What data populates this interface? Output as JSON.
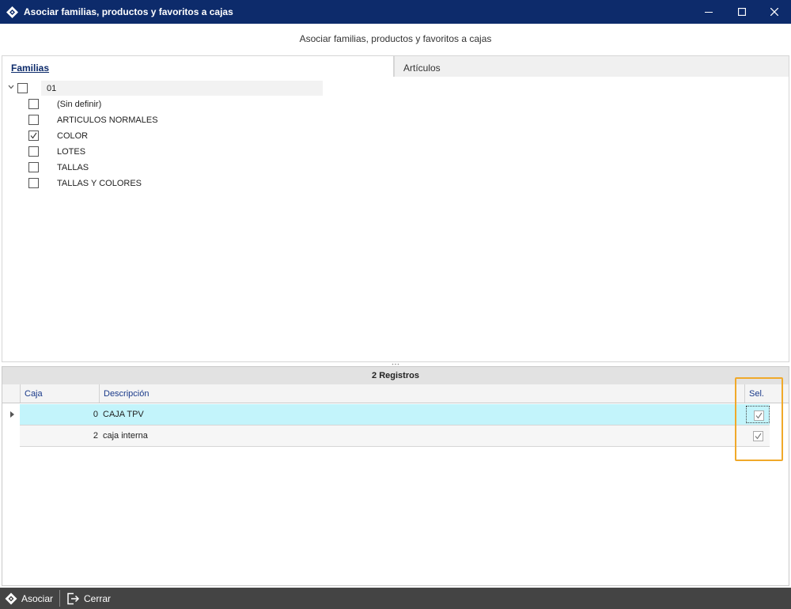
{
  "window": {
    "title": "Asociar familias, productos y favoritos a cajas",
    "controls": [
      "minimize-icon",
      "maximize-icon",
      "close-icon"
    ]
  },
  "header": {
    "subtitle": "Asociar familias, productos y favoritos a cajas"
  },
  "tabs": [
    {
      "label": "Familias",
      "active": true
    },
    {
      "label": "Artículos",
      "active": false
    }
  ],
  "tree": {
    "root": {
      "label": "01",
      "checked": false,
      "expanded": true
    },
    "items": [
      {
        "label": "(Sin definir)",
        "checked": false
      },
      {
        "label": "ARTICULOS NORMALES",
        "checked": false
      },
      {
        "label": "COLOR",
        "checked": true
      },
      {
        "label": "LOTES",
        "checked": false
      },
      {
        "label": "TALLAS",
        "checked": false
      },
      {
        "label": "TALLAS Y COLORES",
        "checked": false
      }
    ]
  },
  "grid": {
    "group_label": "2 Registros",
    "columns": [
      "Caja",
      "Descripción",
      "Sel."
    ],
    "rows": [
      {
        "caja": "0",
        "descripcion": "CAJA TPV",
        "sel": true,
        "current": true
      },
      {
        "caja": "2",
        "descripcion": "caja interna",
        "sel": true,
        "current": false
      }
    ]
  },
  "toolbar": {
    "asociar_label": "Asociar",
    "cerrar_label": "Cerrar"
  },
  "colors": {
    "titlebar": "#0d2b6b",
    "selected_row": "#c3f4fb",
    "highlight": "#f0a92a",
    "toolbar": "#444444"
  }
}
